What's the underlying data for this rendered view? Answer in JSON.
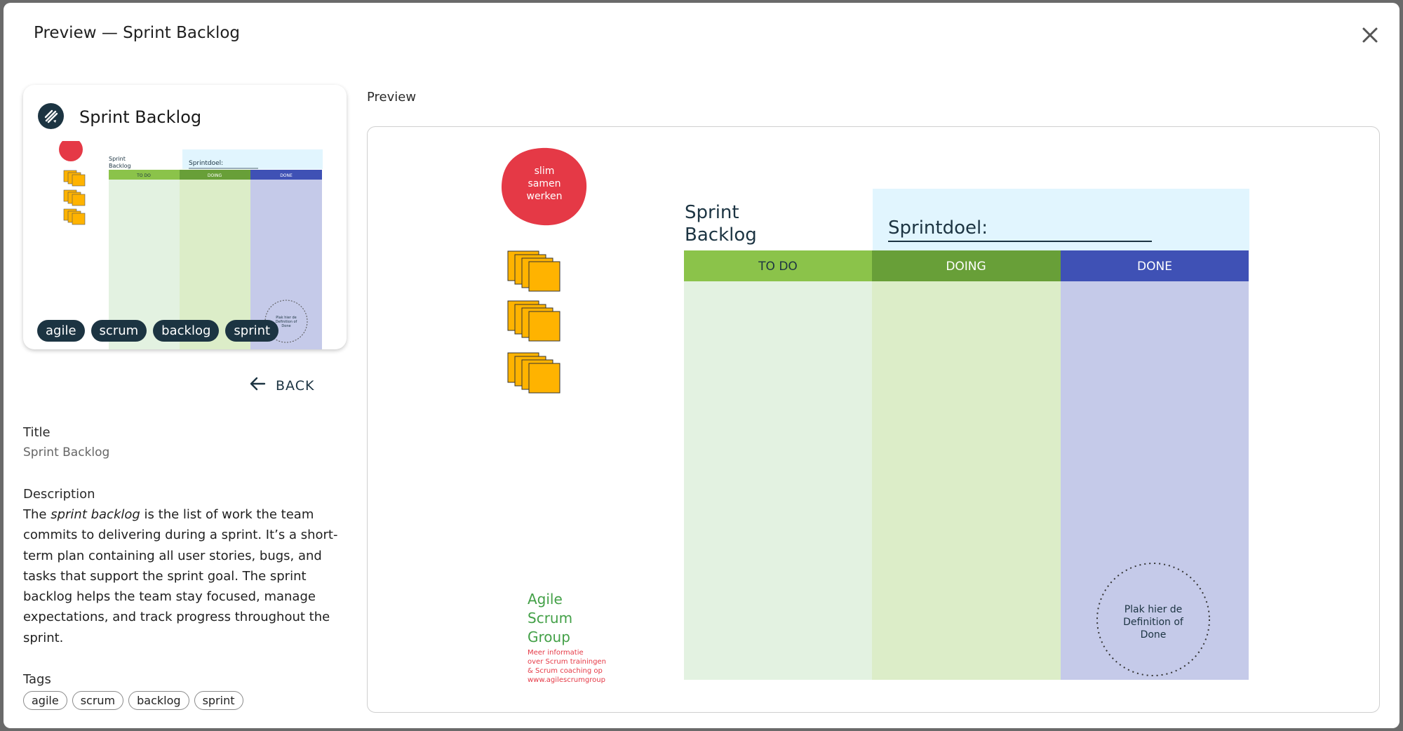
{
  "modal": {
    "title": "Preview — Sprint Backlog"
  },
  "card": {
    "title": "Sprint Backlog",
    "chips": [
      "agile",
      "scrum",
      "backlog",
      "sprint"
    ]
  },
  "back": {
    "label": "BACK"
  },
  "details": {
    "title_label": "Title",
    "title_value": "Sprint Backlog",
    "description_label": "Description",
    "description": {
      "before": "The ",
      "emphasis": "sprint backlog",
      "after": " is the list of work the team commits to delivering during a sprint. It’s a short-term plan containing all user stories, bugs, and tasks that support the sprint goal. The sprint backlog helps the team stay focused, manage expectations, and track progress throughout the sprint."
    },
    "tags_label": "Tags",
    "tags": [
      "agile",
      "scrum",
      "backlog",
      "sprint"
    ]
  },
  "preview": {
    "label": "Preview",
    "badge": [
      "slim",
      "samen",
      "werken"
    ],
    "board_title": [
      "Sprint",
      "Backlog"
    ],
    "sprint_goal": "Sprintdoel:",
    "columns": [
      "TO DO",
      "DOING",
      "DONE"
    ],
    "dod": [
      "Plak hier de",
      "Definition of",
      "Done"
    ],
    "brand": [
      "Agile",
      "Scrum",
      "Group"
    ],
    "brand_info": [
      "Meer informatie",
      "over Scrum trainingen",
      "& Scrum coaching op",
      "www.agilescrumgroup"
    ]
  },
  "thumbnail": {
    "board_title": [
      "Sprint",
      "Backlog"
    ],
    "sprint_goal": "Sprintdoel:",
    "columns": [
      "TO DO",
      "DOING",
      "DONE"
    ],
    "dod": [
      "Plak hier de",
      "Definition of",
      "Done"
    ]
  },
  "colors": {
    "todo_header": "#8bc34a",
    "doing_header": "#689f38",
    "done_header": "#3f51b5",
    "todo_body": "#e3f2e1",
    "doing_body": "#dcedc8",
    "done_body": "#c5cae9",
    "goal_bg": "#e1f5fe",
    "badge": "#e53946",
    "sticky": "#ffb300",
    "brand": "#43a047",
    "dark": "#1c3442"
  }
}
